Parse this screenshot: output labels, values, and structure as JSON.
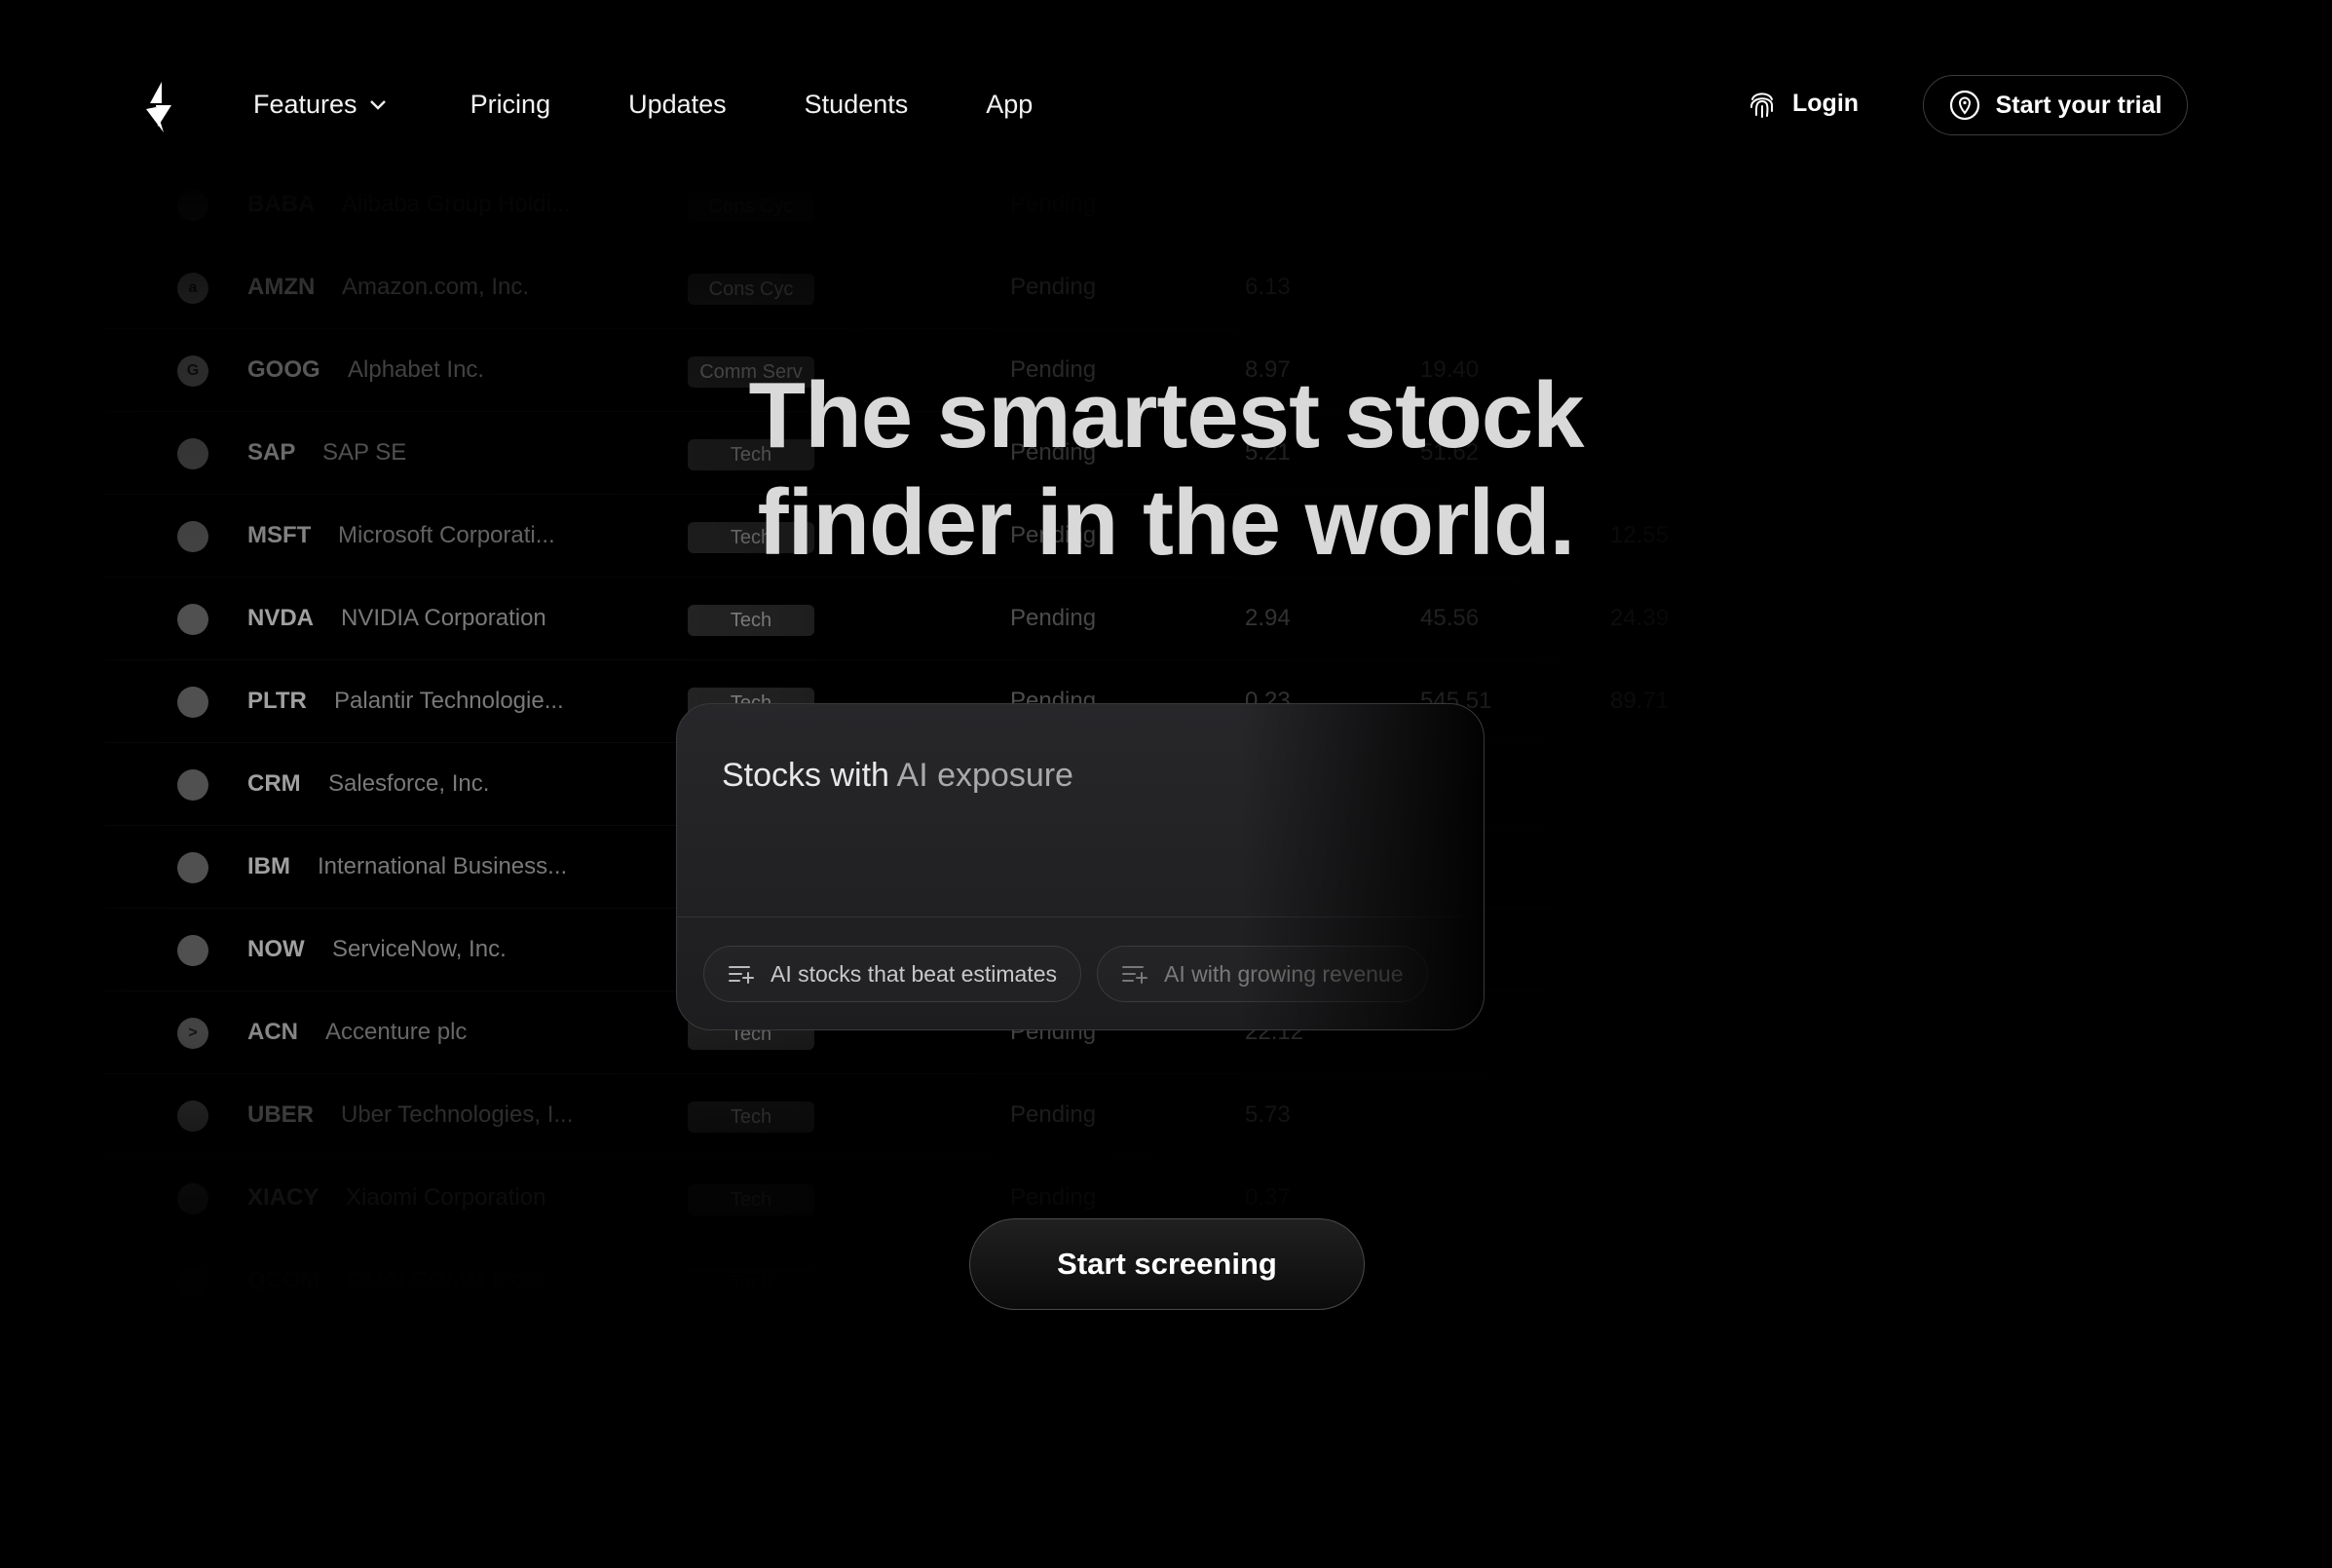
{
  "nav": {
    "logo": "brand-logo",
    "links": [
      {
        "label": "Features",
        "has_dropdown": true
      },
      {
        "label": "Pricing"
      },
      {
        "label": "Updates"
      },
      {
        "label": "Students"
      },
      {
        "label": "App"
      }
    ],
    "login_label": "Login",
    "trial_label": "Start your trial"
  },
  "hero": {
    "title_line1": "The smartest stock",
    "title_line2": "finder in the world."
  },
  "search": {
    "query_prefix": "Stocks with",
    "query_highlight": "AI exposure",
    "suggestions": [
      "AI stocks that beat estimates",
      "AI with growing revenue"
    ]
  },
  "cta_label": "Start screening",
  "table_rows": [
    {
      "logo": "",
      "ticker": "BABA",
      "name": "Alibaba Group Holdi...",
      "sector": "Cons Cyc",
      "status": "Pending",
      "v1": "",
      "v2": "",
      "v3": ""
    },
    {
      "logo": "a",
      "ticker": "AMZN",
      "name": "Amazon.com, Inc.",
      "sector": "Cons Cyc",
      "status": "Pending",
      "v1": "6.13",
      "v2": "",
      "v3": ""
    },
    {
      "logo": "G",
      "ticker": "GOOG",
      "name": "Alphabet Inc.",
      "sector": "Comm Serv",
      "status": "Pending",
      "v1": "8.97",
      "v2": "19.40",
      "v3": ""
    },
    {
      "logo": "",
      "ticker": "SAP",
      "name": "SAP SE",
      "sector": "Tech",
      "status": "Pending",
      "v1": "5.21",
      "v2": "51.62",
      "v3": ""
    },
    {
      "logo": "",
      "ticker": "MSFT",
      "name": "Microsoft Corporati...",
      "sector": "Tech",
      "status": "Pending",
      "v1": "",
      "v2": "",
      "v3": "12.55"
    },
    {
      "logo": "",
      "ticker": "NVDA",
      "name": "NVIDIA Corporation",
      "sector": "Tech",
      "status": "Pending",
      "v1": "2.94",
      "v2": "45.56",
      "v3": "24.39"
    },
    {
      "logo": "",
      "ticker": "PLTR",
      "name": "Palantir Technologie...",
      "sector": "Tech",
      "status": "Pending",
      "v1": "0.23",
      "v2": "545.51",
      "v3": "89.71"
    },
    {
      "logo": "",
      "ticker": "CRM",
      "name": "Salesforce, Inc.",
      "sector": "",
      "status": "",
      "v1": "",
      "v2": "",
      "v3": ""
    },
    {
      "logo": "",
      "ticker": "IBM",
      "name": "International Business...",
      "sector": "",
      "status": "",
      "v1": "",
      "v2": "",
      "v3": ""
    },
    {
      "logo": "",
      "ticker": "NOW",
      "name": "ServiceNow, Inc.",
      "sector": "",
      "status": "",
      "v1": "",
      "v2": "",
      "v3": ""
    },
    {
      "logo": ">",
      "ticker": "ACN",
      "name": "Accenture plc",
      "sector": "Tech",
      "status": "Pending",
      "v1": "22.12",
      "v2": "",
      "v3": ""
    },
    {
      "logo": "",
      "ticker": "UBER",
      "name": "Uber Technologies, I...",
      "sector": "Tech",
      "status": "Pending",
      "v1": "5.73",
      "v2": "",
      "v3": ""
    },
    {
      "logo": "",
      "ticker": "XIACY",
      "name": "Xiaomi Corporation",
      "sector": "Tech",
      "status": "Pending",
      "v1": "0.37",
      "v2": "",
      "v3": ""
    },
    {
      "logo": "",
      "ticker": "QCOM",
      "name": "QUALCOMM Incor...",
      "sector": "Tech",
      "status": "",
      "v1": "",
      "v2": "",
      "v3": ""
    }
  ],
  "colors": {
    "background": "#000000",
    "title": "#d9d9d9",
    "card": "#222224",
    "border": "#39393b"
  }
}
